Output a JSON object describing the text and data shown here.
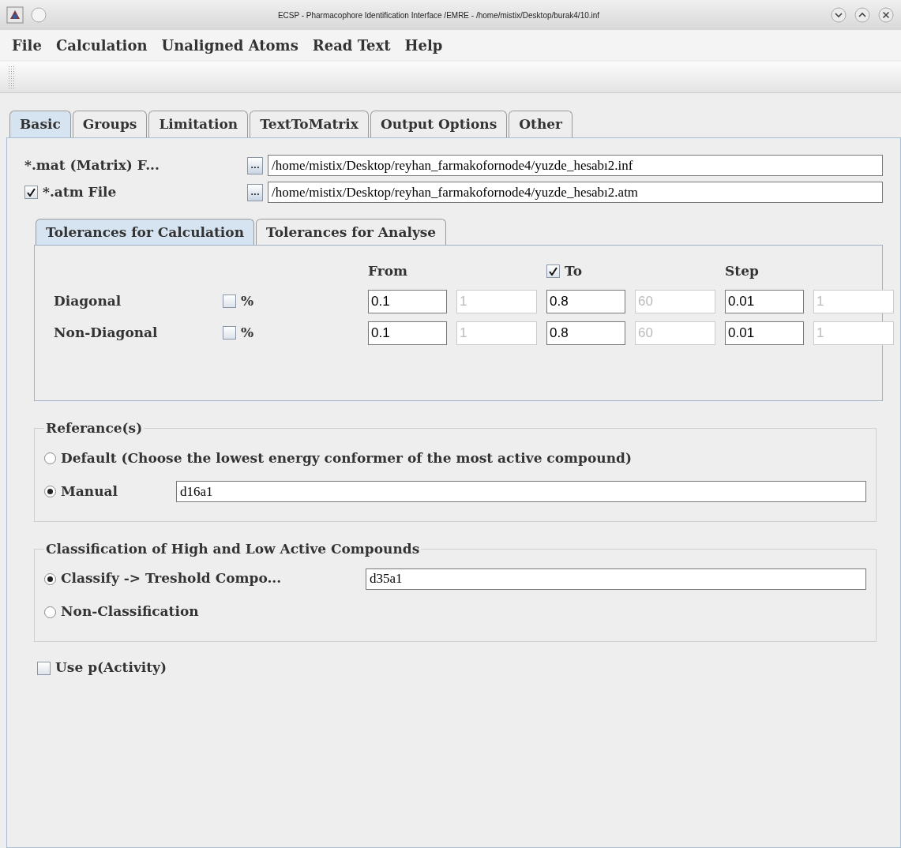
{
  "window": {
    "title": "ECSP - Pharmacophore Identification Interface /EMRE - /home/mistix/Desktop/burak4/10.inf"
  },
  "menu": [
    "File",
    "Calculation",
    "Unaligned Atoms",
    "Read Text",
    "Help"
  ],
  "tabs": [
    {
      "label": "Basic",
      "selected": true
    },
    {
      "label": "Groups",
      "selected": false
    },
    {
      "label": "Limitation",
      "selected": false
    },
    {
      "label": "TextToMatrix",
      "selected": false
    },
    {
      "label": "Output Options",
      "selected": false
    },
    {
      "label": "Other",
      "selected": false
    }
  ],
  "files": [
    {
      "kind": "plain",
      "label": "*.mat (Matrix) F...",
      "browse": "...",
      "value": "/home/mistix/Desktop/reyhan_farmakofornode4/yuzde_hesabı2.inf"
    },
    {
      "kind": "checkbox",
      "checked": true,
      "label": "*.atm File",
      "browse": "...",
      "value": "/home/mistix/Desktop/reyhan_farmakofornode4/yuzde_hesabı2.atm"
    }
  ],
  "tolerance_tabs": [
    {
      "label": "Tolerances for Calculation",
      "selected": true
    },
    {
      "label": "Tolerances for Analyse",
      "selected": false
    }
  ],
  "tolerance_headers": [
    {
      "kind": "plain",
      "label": "From"
    },
    {
      "kind": "checkbox",
      "label": "To",
      "checked": true
    },
    {
      "kind": "plain",
      "label": "Step"
    }
  ],
  "tolerance_rows": [
    {
      "label": "Diagonal",
      "percent": "%",
      "percent_checked": false,
      "fields": [
        {
          "value": "0.1",
          "disabled": false
        },
        {
          "value": "1",
          "disabled": true
        },
        {
          "value": "0.8",
          "disabled": false
        },
        {
          "value": "60",
          "disabled": true
        },
        {
          "value": "0.01",
          "disabled": false
        },
        {
          "value": "1",
          "disabled": true
        }
      ]
    },
    {
      "label": "Non-Diagonal",
      "percent": "%",
      "percent_checked": false,
      "fields": [
        {
          "value": "0.1",
          "disabled": false
        },
        {
          "value": "1",
          "disabled": true
        },
        {
          "value": "0.8",
          "disabled": false
        },
        {
          "value": "60",
          "disabled": true
        },
        {
          "value": "0.01",
          "disabled": false
        },
        {
          "value": "1",
          "disabled": true
        }
      ]
    }
  ],
  "references": {
    "title": "Referance(s)",
    "options": [
      {
        "label": "Default (Choose the lowest energy conformer of the most active compound)",
        "selected": false
      },
      {
        "label": "Manual",
        "selected": true,
        "value": "d16a1"
      }
    ]
  },
  "classification": {
    "title": "Classification of High and Low Active Compounds",
    "options": [
      {
        "label": "Classify -> Treshold Compo...",
        "selected": true,
        "value": "d35a1"
      },
      {
        "label": "Non-Classification",
        "selected": false
      }
    ]
  },
  "use_activity": {
    "label": "Use p(Activity)",
    "checked": false
  }
}
